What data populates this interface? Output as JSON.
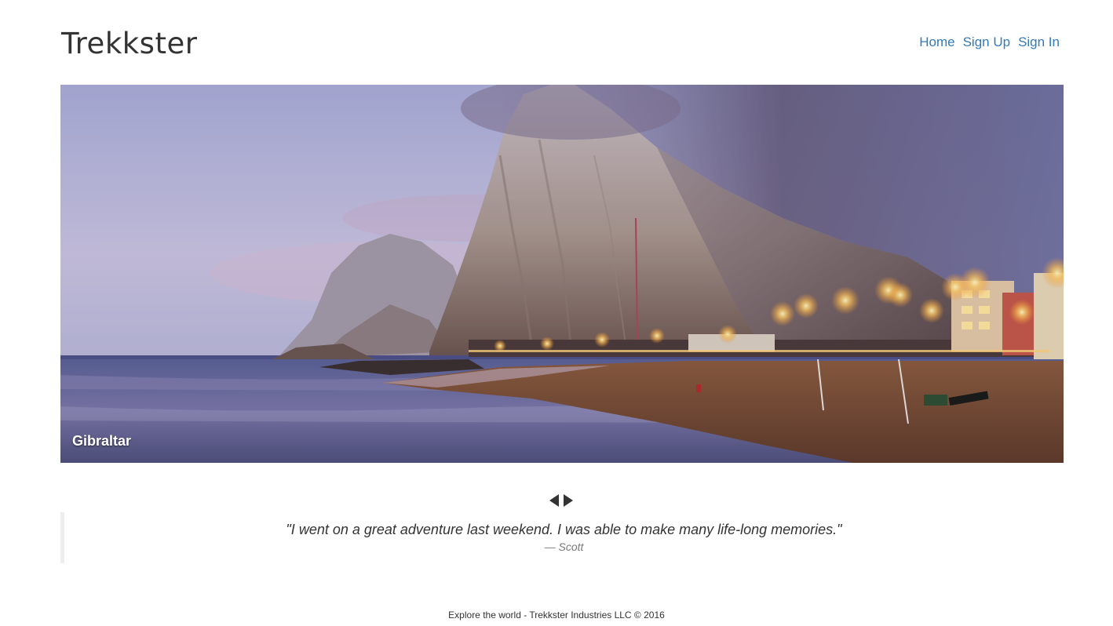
{
  "header": {
    "brand": "Trekkster",
    "nav": {
      "home": "Home",
      "sign_up": "Sign Up",
      "sign_in": "Sign In"
    }
  },
  "carousel": {
    "caption": "Gibraltar",
    "prev_icon": "triangle-left-icon",
    "next_icon": "triangle-right-icon"
  },
  "testimonial": {
    "quote": "\"I went on a great adventure last weekend. I was able to make many life-long memories.\"",
    "author": "— Scott"
  },
  "footer": {
    "text": "Explore the world - Trekkster Industries LLC © 2016"
  },
  "colors": {
    "link": "#337ab7",
    "brand": "#333333",
    "quote_border": "#eeeeee"
  }
}
